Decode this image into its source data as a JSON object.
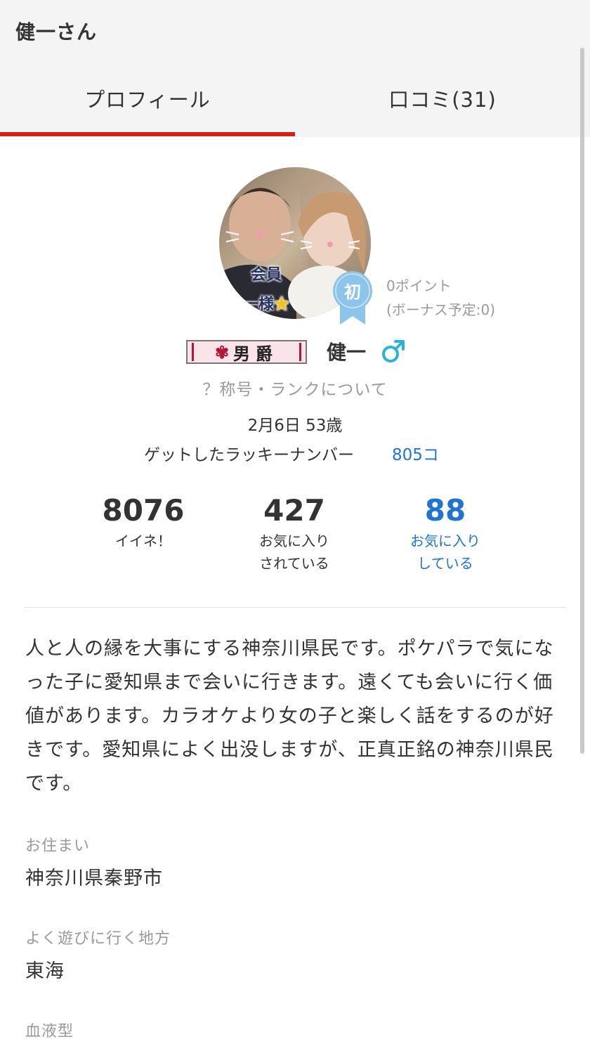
{
  "header": {
    "title": "健一さん",
    "tabs": [
      {
        "label": "プロフィール",
        "active": true
      },
      {
        "label": "口コミ(31)",
        "active": false
      }
    ]
  },
  "profile": {
    "avatar_caption_line1": "会員",
    "avatar_caption_line2": "一様",
    "first_badge": "初",
    "points_line1": "0ポイント",
    "points_line2": "(ボーナス予定:0)",
    "rank_title": "男爵",
    "username": "健一",
    "gender_icon": "male-icon",
    "rank_about_link": "？称号・ランクについて",
    "birth_age": "2月6日 53歳",
    "lucky_label": "ゲットしたラッキーナンバー",
    "lucky_value": "805コ"
  },
  "stats": [
    {
      "value": "8076",
      "label_line1": "イイネ！",
      "label_line2": ""
    },
    {
      "value": "427",
      "label_line1": "お気に入り",
      "label_line2": "されている"
    },
    {
      "value": "88",
      "label_line1": "お気に入り",
      "label_line2": "している"
    }
  ],
  "bio": "人と人の縁を大事にする神奈川県民です。ポケパラで気になった子に愛知県まで会いに行きます。遠くても会いに行く価値があります。カラオケより女の子と楽しく話をするのが好きです。愛知県によく出没しますが、正真正銘の神奈川県民です。",
  "fields": [
    {
      "label": "お住まい",
      "value": "神奈川県秦野市"
    },
    {
      "label": "よく遊びに行く地方",
      "value": "東海"
    },
    {
      "label": "血液型",
      "value": ""
    }
  ],
  "colors": {
    "accent_red": "#d3221a",
    "link_blue": "#1f74d1",
    "male_icon": "#2bb3d6",
    "badge_blue": "#8cc4ec"
  }
}
